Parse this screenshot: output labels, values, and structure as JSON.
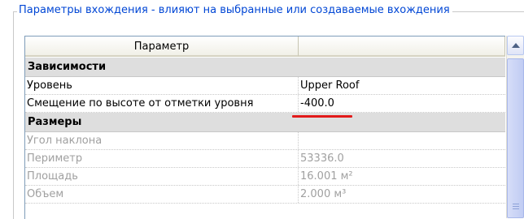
{
  "groupbox": {
    "title": "Параметры вхождения - влияют на выбранные или создаваемые вхождения"
  },
  "table": {
    "headers": {
      "parameter": "Параметр",
      "value": ""
    },
    "groups": [
      {
        "name": "Зависимости",
        "rows": [
          {
            "param": "Уровень",
            "value": "Upper Roof",
            "enabled": true
          },
          {
            "param": "Смещение по высоте от отметки уровня",
            "value": "-400.0",
            "enabled": true,
            "highlighted": true
          }
        ]
      },
      {
        "name": "Размеры",
        "rows": [
          {
            "param": "Угол наклона",
            "value": "",
            "enabled": false
          },
          {
            "param": "Периметр",
            "value": "53336.0",
            "enabled": false
          },
          {
            "param": "Площадь",
            "value": "16.001 м²",
            "enabled": false
          },
          {
            "param": "Объем",
            "value": "2.000 м³",
            "enabled": false
          }
        ]
      }
    ]
  },
  "colors": {
    "title_blue": "#0046d5",
    "group_bg": "#dedede",
    "disabled_text": "#a0a0a0",
    "highlight_red": "#e21a1a"
  }
}
